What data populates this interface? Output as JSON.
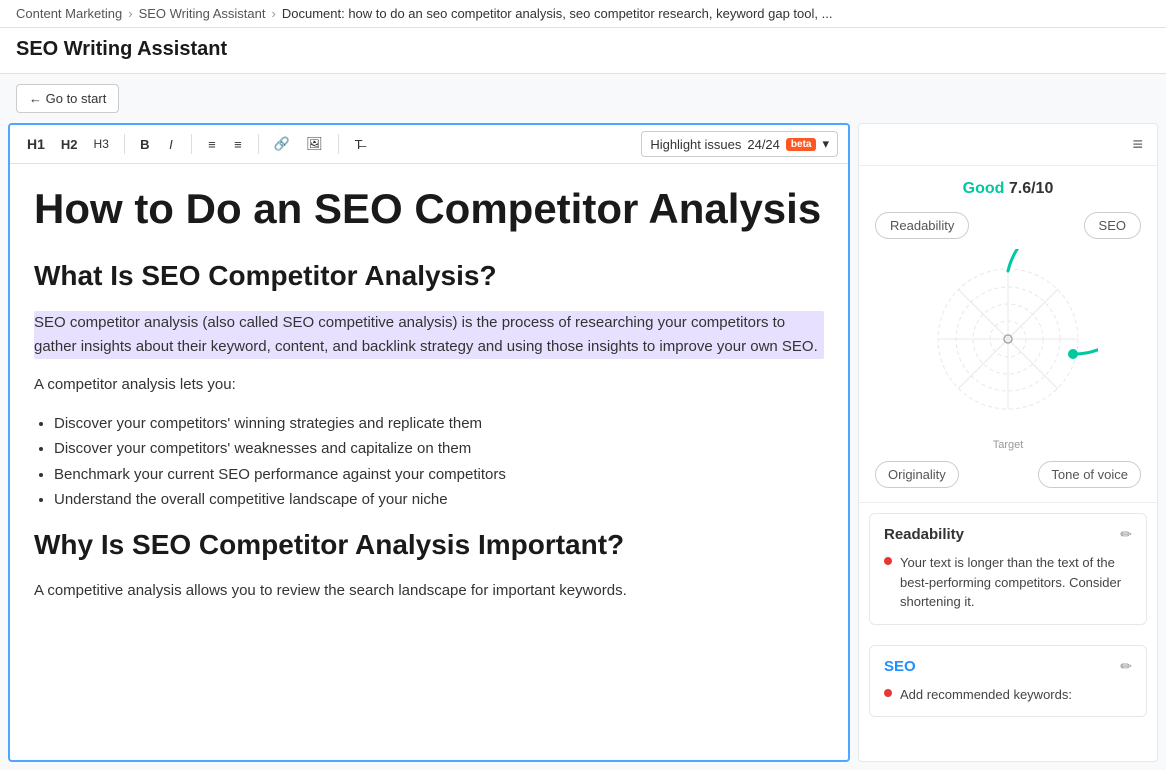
{
  "breadcrumb": {
    "items": [
      {
        "label": "Content Marketing",
        "link": true
      },
      {
        "label": "SEO Writing Assistant",
        "link": true
      },
      {
        "label": "Document: how to do an seo competitor analysis, seo competitor research, keyword gap tool, ...",
        "link": false
      }
    ]
  },
  "page": {
    "title": "SEO Writing Assistant"
  },
  "toolbar": {
    "go_to_start": "← Go to start"
  },
  "editor": {
    "toolbar": {
      "h1": "H1",
      "h2": "H2",
      "h3": "H3",
      "bold": "B",
      "italic": "I",
      "highlight_issues": "Highlight issues",
      "count": "24/24",
      "beta": "beta"
    },
    "content": {
      "h1": "How to Do an SEO Competitor Analysis",
      "h2_1": "What Is SEO Competitor Analysis?",
      "p1": "SEO competitor analysis (also called SEO competitive analysis) is the process of researching your competitors to gather insights about their keyword, content, and backlink strategy and using those insights to improve your own SEO.",
      "p2": "A competitor analysis lets you:",
      "bullets": [
        "Discover your competitors' winning strategies and replicate them",
        "Discover your competitors' weaknesses and capitalize on them",
        "Benchmark your current SEO performance against your competitors",
        "Understand the overall competitive landscape of your niche"
      ],
      "h2_2": "Why Is SEO Competitor Analysis Important?",
      "p3": "A competitive analysis allows you to review the search landscape for important keywords."
    }
  },
  "right_panel": {
    "menu_icon": "≡",
    "score": {
      "label_good": "Good",
      "score_value": "7.6",
      "score_max": "/10",
      "tab_readability": "Readability",
      "tab_seo": "SEO",
      "target_label": "Target",
      "tab_originality": "Originality",
      "tab_tone_of_voice": "Tone of voice"
    },
    "readability_card": {
      "title": "Readability",
      "edit_icon": "✏",
      "item": "Your text is longer than the text of the best-performing competitors. Consider shortening it."
    },
    "seo_card": {
      "title": "SEO",
      "edit_icon": "✏",
      "item": "Add recommended keywords:"
    }
  }
}
